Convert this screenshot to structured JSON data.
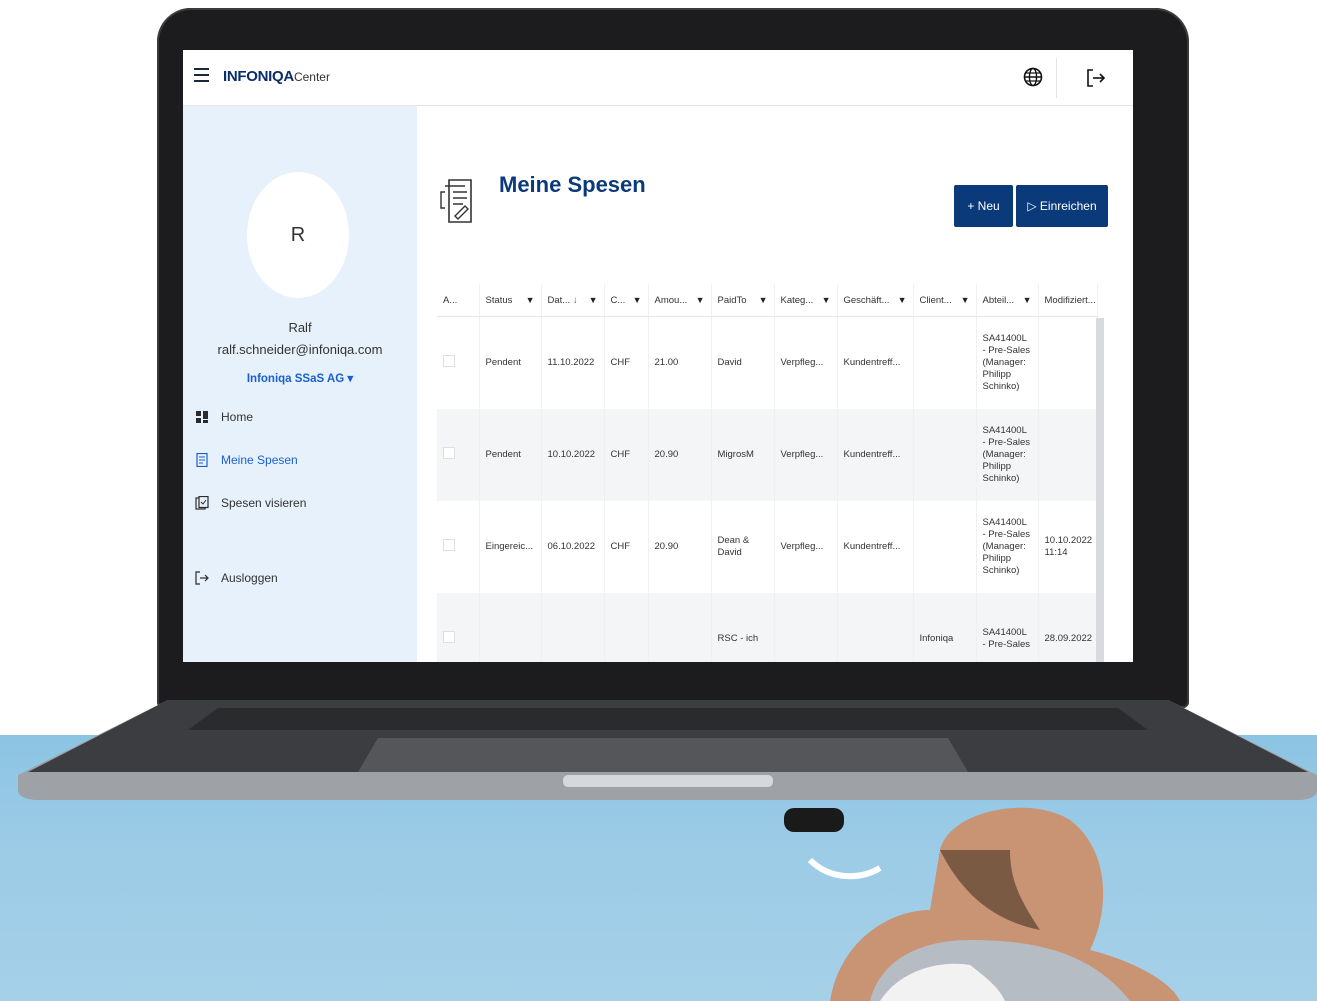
{
  "header": {
    "brand_main": "INFONIQA",
    "brand_sub": "Center"
  },
  "sidebar": {
    "avatar_initial": "R",
    "user_name": "Ralf",
    "user_email": "ralf.schneider@infoniqa.com",
    "company": "Infoniqa SSaS AG ▾",
    "items": [
      {
        "label": "Home",
        "icon": "home-icon"
      },
      {
        "label": "Meine Spesen",
        "icon": "expense-icon"
      },
      {
        "label": "Spesen visieren",
        "icon": "approve-icon"
      },
      {
        "label": "Ausloggen",
        "icon": "logout-icon"
      }
    ]
  },
  "main": {
    "title": "Meine Spesen",
    "new_button": "+ Neu",
    "submit_button": "▷ Einreichen"
  },
  "table": {
    "columns": [
      "A...",
      "Status",
      "Dat...",
      "C...",
      "Amou...",
      "PaidTo",
      "Kateg...",
      "Geschäft...",
      "Client...",
      "Abteil...",
      "Modifiziert..."
    ],
    "rows": [
      {
        "status": "Pendent",
        "date": "11.10.2022",
        "currency": "CHF",
        "amount": "21.00",
        "paid_to": "David",
        "category": "Verpfleg...",
        "business": "Kundentreff...",
        "client": "",
        "department": "SA41400L - Pre-Sales (Manager: Philipp Schinko)",
        "modified": ""
      },
      {
        "status": "Pendent",
        "date": "10.10.2022",
        "currency": "CHF",
        "amount": "20.90",
        "paid_to": "MigrosM",
        "category": "Verpfleg...",
        "business": "Kundentreff...",
        "client": "",
        "department": "SA41400L - Pre-Sales (Manager: Philipp Schinko)",
        "modified": ""
      },
      {
        "status": "Eingereic...",
        "date": "06.10.2022",
        "currency": "CHF",
        "amount": "20.90",
        "paid_to": "Dean & David",
        "category": "Verpfleg...",
        "business": "Kundentreff...",
        "client": "",
        "department": "SA41400L - Pre-Sales (Manager: Philipp Schinko)",
        "modified": "10.10.2022 11:14"
      },
      {
        "status": "",
        "date": "",
        "currency": "",
        "amount": "",
        "paid_to": "RSC - ich",
        "category": "",
        "business": "",
        "client": "Infoniqa",
        "department": "SA41400L - Pre-Sales",
        "modified": "28.09.2022"
      }
    ]
  },
  "colors": {
    "brand": "#0b3a7a",
    "link": "#1a5fd0",
    "sidebar_bg": "#e6f1fb"
  }
}
